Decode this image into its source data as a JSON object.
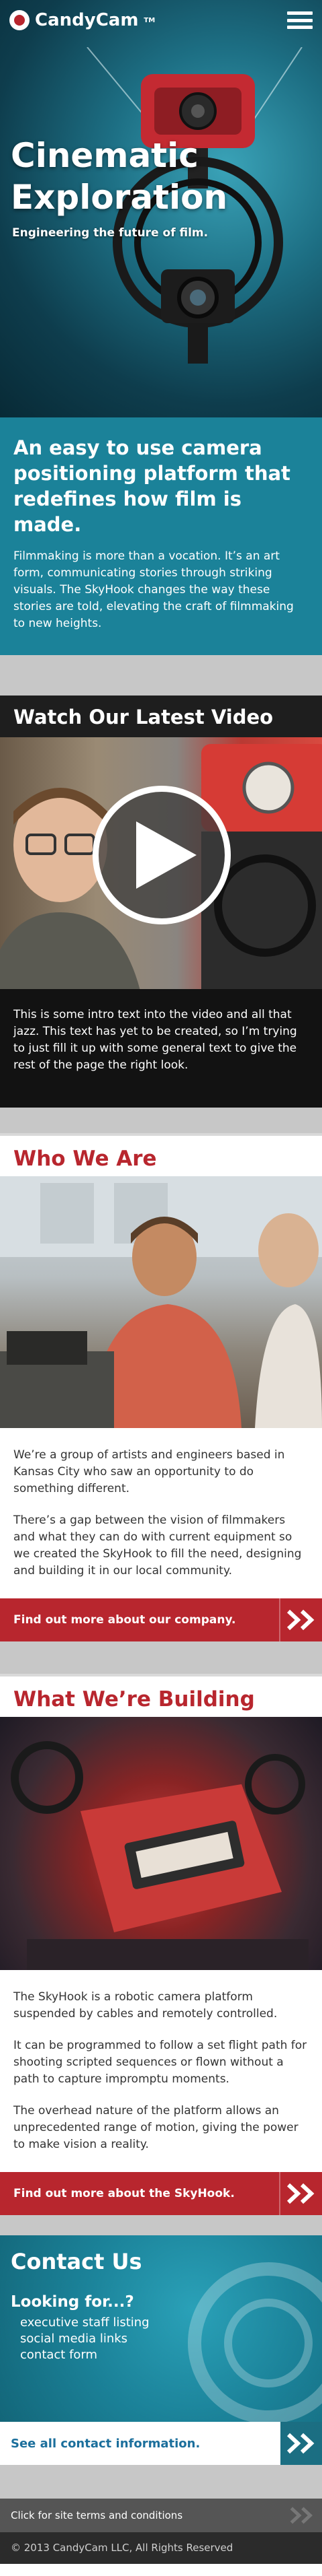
{
  "header": {
    "brand": "CandyCam",
    "menu_icon": "hamburger-menu-icon"
  },
  "hero": {
    "title_line1": "Cinematic",
    "title_line2": "Exploration",
    "subtitle": "Engineering the future of film."
  },
  "intro": {
    "heading": "An easy to use camera positioning platform that redefines how film is made.",
    "paragraph": "Filmmaking is more than a vocation. It’s an art form, communicating stories through striking visuals. The SkyHook changes the way these stories are told, elevating the craft of filmmaking to new heights."
  },
  "video": {
    "heading": "Watch Our Latest Video",
    "play_icon": "play-icon",
    "intro_text": "This is some intro text into the video and all that jazz. This text has yet to be created, so I’m trying to just fill it up with some general text to give the rest of the page the right look."
  },
  "who": {
    "heading": "Who We Are",
    "paragraph1": "We’re a group of artists and engineers based in Kansas City who saw an opportunity to do something different.",
    "paragraph2": "There’s a gap between the vision of filmmakers and what they can do with current equipment so we created the SkyHook to fill the need, designing and building it in our local community.",
    "cta": "Find out more about our company."
  },
  "building": {
    "heading": "What We’re Building",
    "paragraph1": "The SkyHook is a robotic camera platform suspended by cables and remotely controlled.",
    "paragraph2": "It can be programmed to follow a set flight path for shooting scripted sequences or flown without a path to capture impromptu moments.",
    "paragraph3": "The overhead nature of the platform allows an unprecedented range of motion, giving the power to make vision a reality.",
    "cta": "Find out more about the SkyHook."
  },
  "contact": {
    "heading": "Contact Us",
    "subheading": "Looking for...?",
    "links": [
      "executive staff listing",
      "social media links",
      "contact form"
    ],
    "cta": "See all contact information."
  },
  "footer": {
    "terms_link": "Click for site terms and conditions",
    "copyright": "© 2013 CandyCam LLC, All Rights Reserved"
  },
  "colors": {
    "brand_red": "#b8262e",
    "teal": "#1b8299",
    "dark": "#1e1e1e"
  }
}
